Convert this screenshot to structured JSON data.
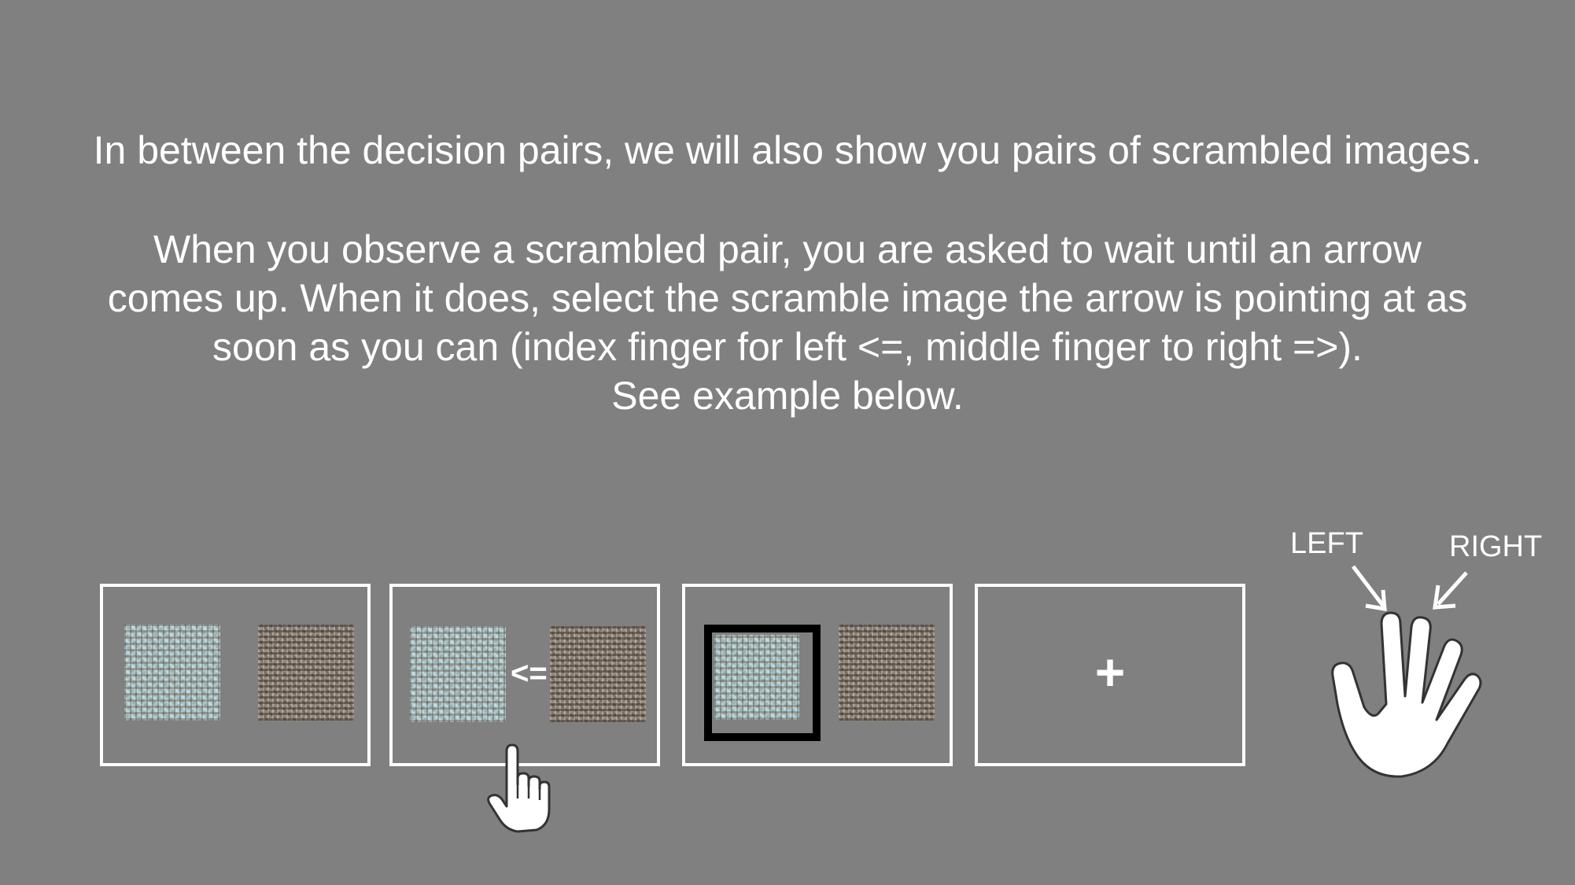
{
  "instructions": {
    "paragraph1": "In between the decision pairs, we will also show you pairs of scrambled images.",
    "paragraph2_lines": [
      "When you observe a scrambled pair, you are asked to wait until an arrow",
      "comes up. When it does, select the scramble image the arrow is pointing at as",
      "soon as you can (index finger for left <=, middle finger to right =>).",
      "See example below."
    ]
  },
  "example_sequence": {
    "frames": [
      {
        "step": "scrambled-pair"
      },
      {
        "step": "arrow-cue",
        "arrow": "<="
      },
      {
        "step": "left-selected"
      },
      {
        "step": "fixation",
        "symbol": "+"
      }
    ]
  },
  "hand_diagram": {
    "left_label": "LEFT",
    "right_label": "RIGHT"
  },
  "icons": {
    "pointer": "hand-pointer-icon",
    "hand": "open-hand-icon"
  },
  "colors": {
    "background": "#808080",
    "text": "#ffffff",
    "selection_border": "#000000",
    "scramble_blue": "#a7c4ca",
    "scramble_brown": "#8a8074"
  }
}
